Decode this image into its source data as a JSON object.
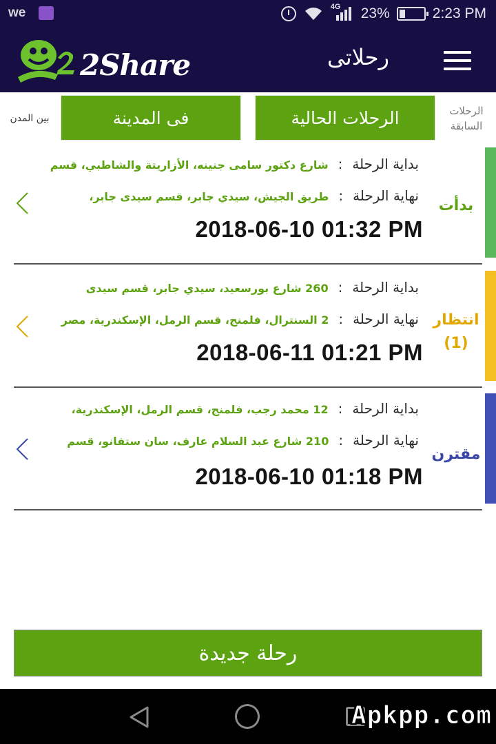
{
  "status_bar": {
    "carrier": "we",
    "network": "4G",
    "battery": "23%",
    "battery_level": 0.23,
    "time": "2:23 PM"
  },
  "app_bar": {
    "logo_text": "2Share",
    "title": "رحلاتى"
  },
  "tabs": {
    "intercity": "بين المدن",
    "in_city": "فى المدينة",
    "current": "الرحلات الحالية",
    "previous": [
      "الرحلات",
      "السابقة"
    ]
  },
  "labels": {
    "start": "بداية الرحلة",
    "end": "نهاية الرحلة",
    "colon": ":"
  },
  "trips": [
    {
      "status": "بدأت",
      "status_sub": "",
      "color": "#5cb85c",
      "text_color": "#5da311",
      "start_address": "شارع دكتور سامى جنينه، الأزاريتة والشاطبي، قسم",
      "end_address": "طريق الجيش، سيدي جابر، قسم سيدى جابر،",
      "datetime": "2018-06-10 01:32 PM"
    },
    {
      "status": "انتظار",
      "status_sub": "(1)",
      "color": "#f4bf20",
      "text_color": "#e0a800",
      "start_address": "260 شارع بورسعيد، سيدي جابر، قسم سيدى",
      "end_address": "2 السنترال، فلمنج، قسم الرمل، الإسكندرية، مصر",
      "datetime": "2018-06-11 01:21 PM"
    },
    {
      "status": "مقترن",
      "status_sub": "",
      "color": "#3f51b5",
      "text_color": "#3a46a8",
      "start_address": "12 محمد رجب، فلمنج، قسم الرمل، الإسكندرية،",
      "end_address": "210 شارع عبد السلام عارف، سان ستفانو، قسم",
      "datetime": "2018-06-10 01:18 PM"
    }
  ],
  "new_trip_button": "رحلة جديدة",
  "watermark": "Apkpp.com",
  "colors": {
    "header_bg": "#170f44",
    "accent_green": "#5da311"
  }
}
